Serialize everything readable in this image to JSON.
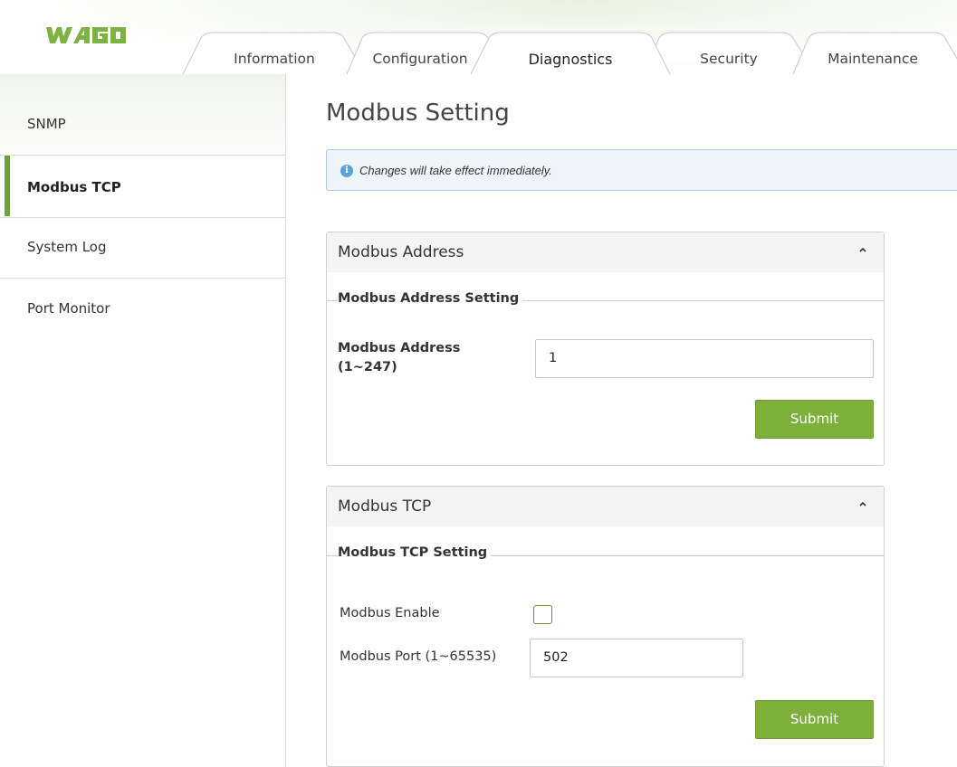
{
  "brand": {
    "logo_text": "WAGO",
    "logo_color": "#7cb342"
  },
  "tabs": [
    {
      "label": "Information",
      "active": false
    },
    {
      "label": "Configuration",
      "active": false
    },
    {
      "label": "Diagnostics",
      "active": true
    },
    {
      "label": "Security",
      "active": false
    },
    {
      "label": "Maintenance",
      "active": false
    }
  ],
  "sidebar": {
    "items": [
      {
        "label": "SNMP",
        "active": false
      },
      {
        "label": "Modbus TCP",
        "active": true
      },
      {
        "label": "System Log",
        "active": false
      },
      {
        "label": "Port Monitor",
        "active": false
      }
    ]
  },
  "page": {
    "title": "Modbus Setting",
    "info": {
      "icon": "info-icon",
      "glyph": "i",
      "text": "Changes will take effect immediately."
    }
  },
  "address_panel": {
    "title": "Modbus Address",
    "collapse_icon": "chevron-up-icon",
    "legend": "Modbus Address Setting",
    "field_label_line1": "Modbus Address",
    "field_label_line2": "(1~247)",
    "value": "1",
    "submit_label": "Submit"
  },
  "tcp_panel": {
    "title": "Modbus TCP",
    "collapse_icon": "chevron-up-icon",
    "legend": "Modbus TCP Setting",
    "enable_label": "Modbus Enable",
    "enable_checked": false,
    "port_label": "Modbus Port (1~65535)",
    "port_value": "502",
    "submit_label": "Submit"
  },
  "colors": {
    "accent": "#6ba33a",
    "button": "#7daf3a",
    "info_bg": "#eef5f9",
    "info_border": "#a9ccdc",
    "info_icon": "#5aa2d2"
  }
}
